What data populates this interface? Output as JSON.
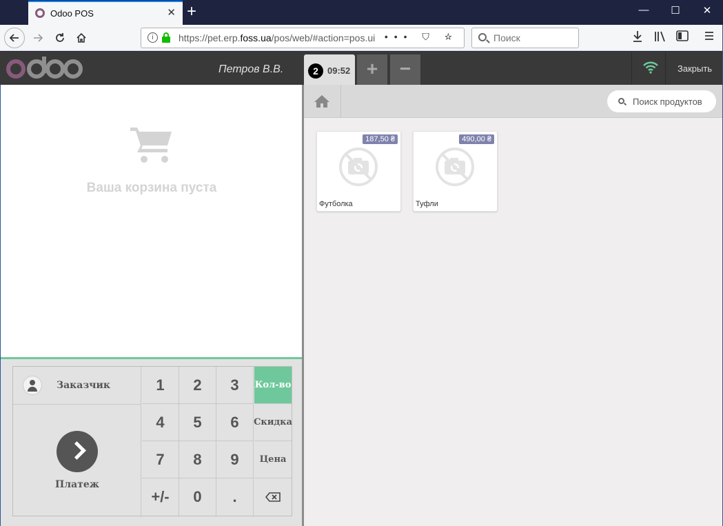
{
  "browser": {
    "tab_title": "Odoo POS",
    "tab_close": "✕",
    "new_tab": "+",
    "url_prefix": "https://pet.erp.",
    "url_domain": "foss.ua",
    "url_path": "/pos/web/#action=pos.ui",
    "url_actions": "••• ⛉ ☆",
    "search_placeholder": "Поиск",
    "win_minimize": "—",
    "win_maximize": "☐",
    "win_close": "✕"
  },
  "header": {
    "cashier": "Петров В.В.",
    "order_number": "2",
    "order_time": "09:52",
    "add_order": "+",
    "remove_order": "−",
    "close_label": "Закрыть",
    "wifi_color": "#6ec89b"
  },
  "cart": {
    "empty_text": "Ваша корзина пуста"
  },
  "actionpad": {
    "customer_label": "Заказчик",
    "payment_label": "Платеж"
  },
  "numpad": {
    "keys": [
      "1",
      "2",
      "3",
      "4",
      "5",
      "6",
      "7",
      "8",
      "9",
      "+/-",
      "0",
      "."
    ],
    "modes": [
      "Кол-во",
      "Скидка",
      "Цена"
    ],
    "active_mode": "Кол-во"
  },
  "products": {
    "search_placeholder": "Поиск продуктов",
    "items": [
      {
        "name": "Футболка",
        "price": "187,50 ₴"
      },
      {
        "name": "Туфли",
        "price": "490,00 ₴"
      }
    ]
  },
  "colors": {
    "brand": "#875a7b",
    "accent": "#6ec89b",
    "price_tag": "#7f82ac"
  }
}
